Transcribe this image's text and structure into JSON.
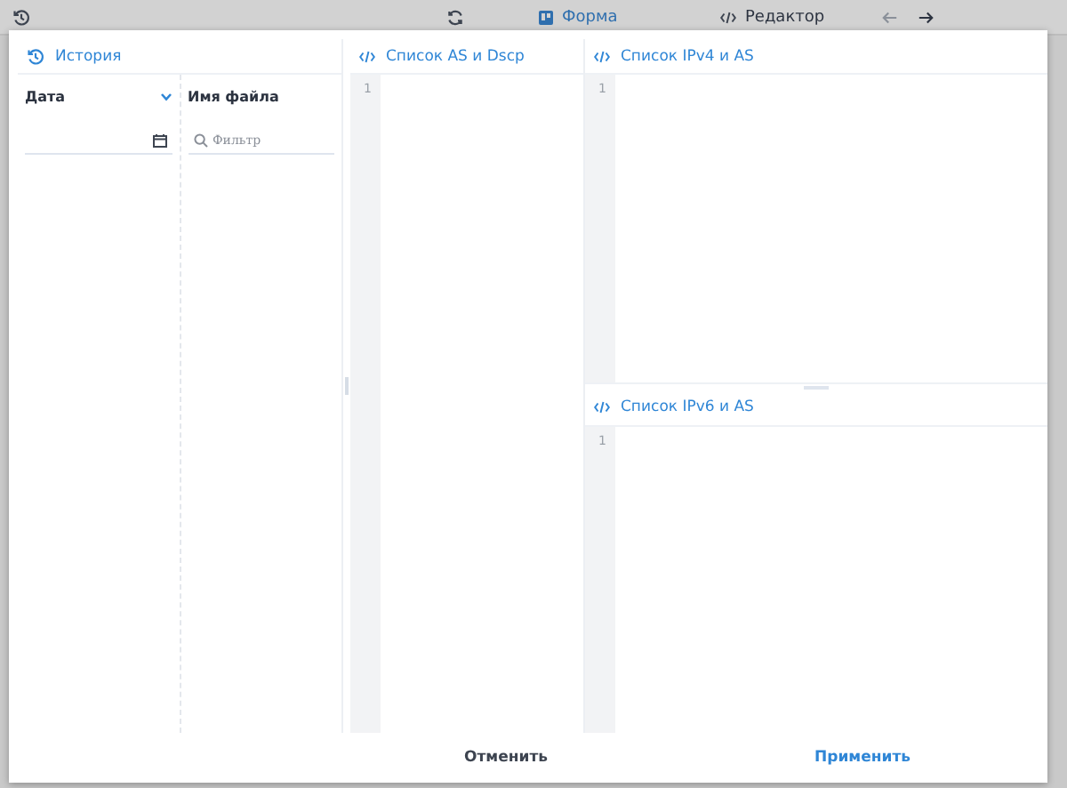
{
  "toolbar": {
    "tabs": [
      {
        "label": "Форма",
        "selected": true
      },
      {
        "label": "Редактор",
        "selected": false
      }
    ]
  },
  "history": {
    "title": "История",
    "date_column": {
      "label": "Дата"
    },
    "file_column": {
      "label": "Имя файла",
      "placeholder": "Фильтр"
    }
  },
  "editors": [
    {
      "title": "Список AS и Dscp",
      "line_numbers": [
        "1"
      ]
    },
    {
      "title": "Список IPv4 и AS",
      "line_numbers": [
        "1"
      ]
    },
    {
      "title": "Список IPv6 и AS",
      "line_numbers": [
        "1"
      ]
    }
  ],
  "buttons": {
    "cancel": "Отменить",
    "apply": "Применить"
  }
}
